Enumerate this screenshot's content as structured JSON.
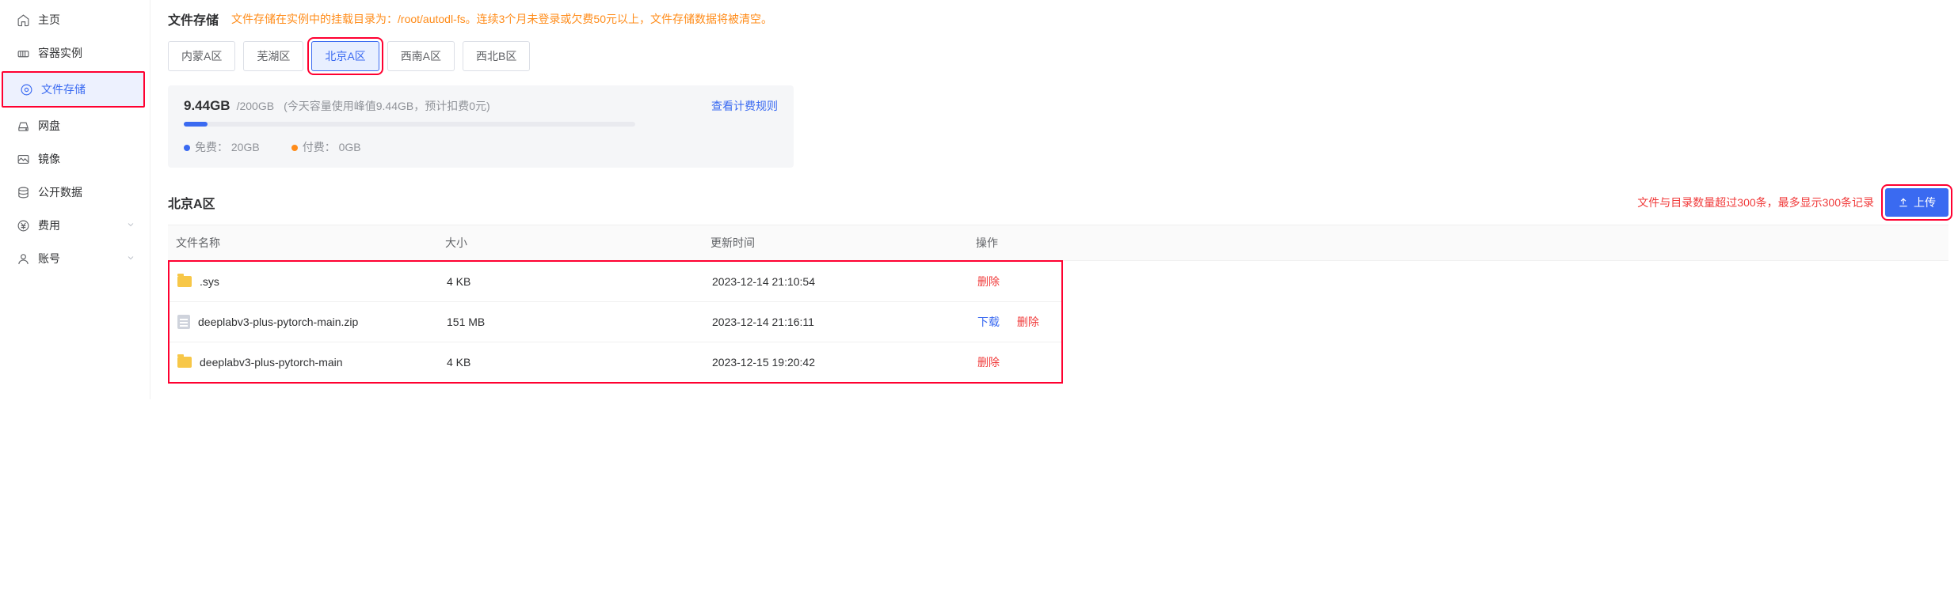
{
  "sidebar": {
    "items": [
      {
        "name": "home",
        "label": "主页",
        "icon": "home-icon",
        "active": false,
        "expandable": false
      },
      {
        "name": "instances",
        "label": "容器实例",
        "icon": "container-icon",
        "active": false,
        "expandable": false
      },
      {
        "name": "storage",
        "label": "文件存储",
        "icon": "storage-icon",
        "active": true,
        "expandable": false
      },
      {
        "name": "netdisk",
        "label": "网盘",
        "icon": "disk-icon",
        "active": false,
        "expandable": false
      },
      {
        "name": "images",
        "label": "镜像",
        "icon": "image-icon",
        "active": false,
        "expandable": false
      },
      {
        "name": "public",
        "label": "公开数据",
        "icon": "database-icon",
        "active": false,
        "expandable": false
      },
      {
        "name": "billing",
        "label": "费用",
        "icon": "yen-icon",
        "active": false,
        "expandable": true
      },
      {
        "name": "account",
        "label": "账号",
        "icon": "user-icon",
        "active": false,
        "expandable": true
      }
    ]
  },
  "header": {
    "title": "文件存储",
    "warning_prefix": "文件存储在实例中的挂载目录为：",
    "warning_path": "/root/autodl-fs",
    "warning_suffix": "。连续3个月未登录或欠费50元以上，文件存储数据将被清空。"
  },
  "regions": {
    "items": [
      "内蒙A区",
      "芜湖区",
      "北京A区",
      "西南A区",
      "西北B区"
    ],
    "active_index": 2
  },
  "storage": {
    "used": "9.44GB",
    "total": "/200GB",
    "hint": "(今天容量使用峰值9.44GB，预计扣费0元)",
    "rules_link": "查看计费规则",
    "free_label": "免费：",
    "free_value": "20GB",
    "paid_label": "付费：",
    "paid_value": "0GB",
    "percent": 4.72
  },
  "section": {
    "heading": "北京A区",
    "limit_msg": "文件与目录数量超过300条，最多显示300条记录",
    "upload_label": "上传"
  },
  "table": {
    "cols": {
      "name": "文件名称",
      "size": "大小",
      "time": "更新时间",
      "op": "操作"
    },
    "op_download": "下载",
    "op_delete": "删除",
    "rows": [
      {
        "name": ".sys",
        "size": "4 KB",
        "time": "2023-12-14 21:10:54",
        "type": "folder",
        "can_download": false
      },
      {
        "name": "deeplabv3-plus-pytorch-main.zip",
        "size": "151 MB",
        "time": "2023-12-14 21:16:11",
        "type": "file",
        "can_download": true
      },
      {
        "name": "deeplabv3-plus-pytorch-main",
        "size": "4 KB",
        "time": "2023-12-15 19:20:42",
        "type": "folder",
        "can_download": false
      }
    ]
  }
}
